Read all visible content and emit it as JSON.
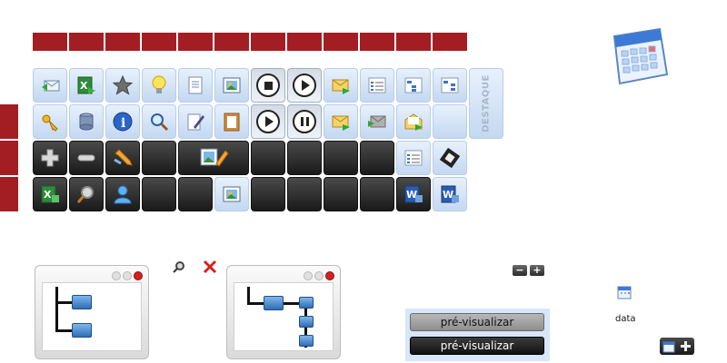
{
  "side_panel": {
    "label": "DESTAQUE"
  },
  "preview_buttons": {
    "primary": "pré-visualizar",
    "secondary": "pré-visualizar"
  },
  "date_widget": {
    "label": "data"
  },
  "zoom_controls": {
    "minus": "−",
    "plus": "+"
  },
  "icon_grid": {
    "row1": [
      "reply-mail-icon",
      "excel-arrow-icon",
      "star-icon",
      "lightbulb-icon",
      "document-icon",
      "image-icon",
      "stop-icon",
      "play-icon",
      "mail-forward-icon",
      "list-icon",
      "tree-icon",
      "tree-icon-2"
    ],
    "row2": [
      "key-icon",
      "tape-icon",
      "info-icon",
      "magnifier-icon",
      "pen-icon",
      "clipboard-icon",
      "play-icon",
      "pause-icon",
      "mail-icon",
      "mail-arrow-icon",
      "mail-open-icon"
    ],
    "row3": [
      "plus-icon",
      "minus-icon",
      "wrench-icon",
      "edit-image-icon",
      "list-icon",
      "film-icon"
    ],
    "row4": [
      "excel-icon",
      "magnifier-icon",
      "user-icon",
      "image-icon",
      "word-icon",
      "word-icon-2"
    ]
  }
}
